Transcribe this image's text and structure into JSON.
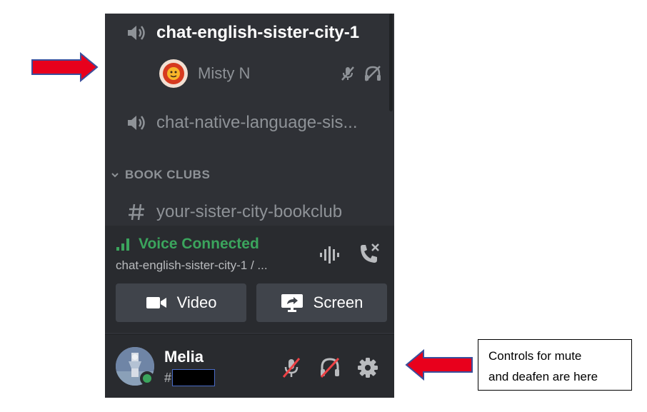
{
  "channels": {
    "active_voice": "chat-english-sister-city-1",
    "member": {
      "name": "Misty N"
    },
    "second_voice": "chat-native-language-sis...",
    "category": "BOOK CLUBS",
    "text_channel": "your-sister-city-bookclub"
  },
  "voice_panel": {
    "status": "Voice Connected",
    "channel": "chat-english-sister-city-1 / ...",
    "video_label": "Video",
    "screen_label": "Screen"
  },
  "user": {
    "name": "Melia",
    "tag_prefix": "#"
  },
  "annotation": {
    "line1": "Controls for mute",
    "line2": "and deafen are here"
  },
  "colors": {
    "panel_bg": "#2f3136",
    "bar_bg": "#292b2f",
    "connected_green": "#3ba55d",
    "muted_red": "#ed4245",
    "arrow_red": "#e8001c"
  },
  "icons": {
    "speaker": "speaker-icon",
    "mic_muted": "mic-muted-icon",
    "headphones_muted": "headphones-muted-icon",
    "signal": "signal-bars-icon",
    "soundwave": "soundwave-icon",
    "disconnect": "disconnect-call-icon",
    "camera": "camera-icon",
    "screen_share": "screen-share-icon",
    "settings": "gear-icon"
  }
}
